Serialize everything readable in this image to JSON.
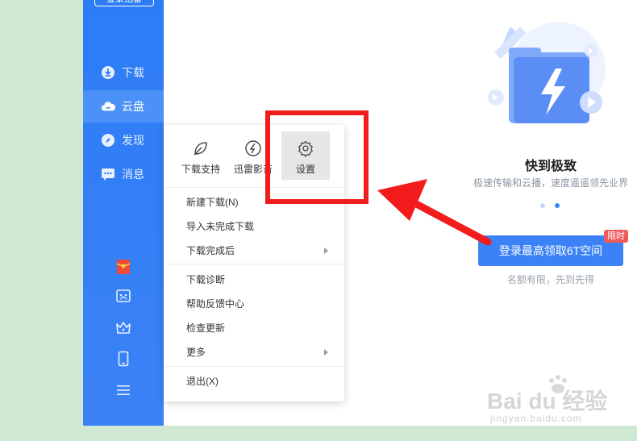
{
  "sidebar": {
    "login_label": "登录迅雷",
    "items": [
      {
        "label": "下载",
        "icon": "download-icon"
      },
      {
        "label": "云盘",
        "icon": "cloud-icon"
      },
      {
        "label": "发现",
        "icon": "compass-icon"
      },
      {
        "label": "消息",
        "icon": "message-icon"
      }
    ],
    "bottom_icons": [
      "red-packet-icon",
      "game-icon",
      "crown-icon",
      "phone-icon",
      "menu-icon"
    ]
  },
  "menu": {
    "quick_actions": [
      {
        "label": "下载支持",
        "icon": "leaf-icon"
      },
      {
        "label": "迅雷影音",
        "icon": "media-player-icon"
      },
      {
        "label": "设置",
        "icon": "gear-icon"
      }
    ],
    "items": [
      {
        "label": "新建下载(N)",
        "submenu": false
      },
      {
        "label": "导入未完成下载",
        "submenu": false
      },
      {
        "label": "下载完成后",
        "submenu": true
      },
      {
        "label": "下载诊断",
        "submenu": false
      },
      {
        "label": "帮助反馈中心",
        "submenu": false
      },
      {
        "label": "检查更新",
        "submenu": false
      },
      {
        "label": "更多",
        "submenu": true
      },
      {
        "label": "退出(X)",
        "submenu": false
      }
    ]
  },
  "promo": {
    "title": "快到极致",
    "subtitle": "极速传输和云播，速度遥遥领先业界",
    "cta_label": "登录最高领取6T空间",
    "badge": "限时",
    "note": "名额有限，先到先得"
  },
  "watermark": {
    "brand": "Bai du 经验",
    "url": "jingyan.baidu.com"
  },
  "colors": {
    "sidebar": "#2d7cf6",
    "accent": "#3b82f6",
    "highlight_box": "#f21c1c",
    "badge": "#f05a5a"
  }
}
